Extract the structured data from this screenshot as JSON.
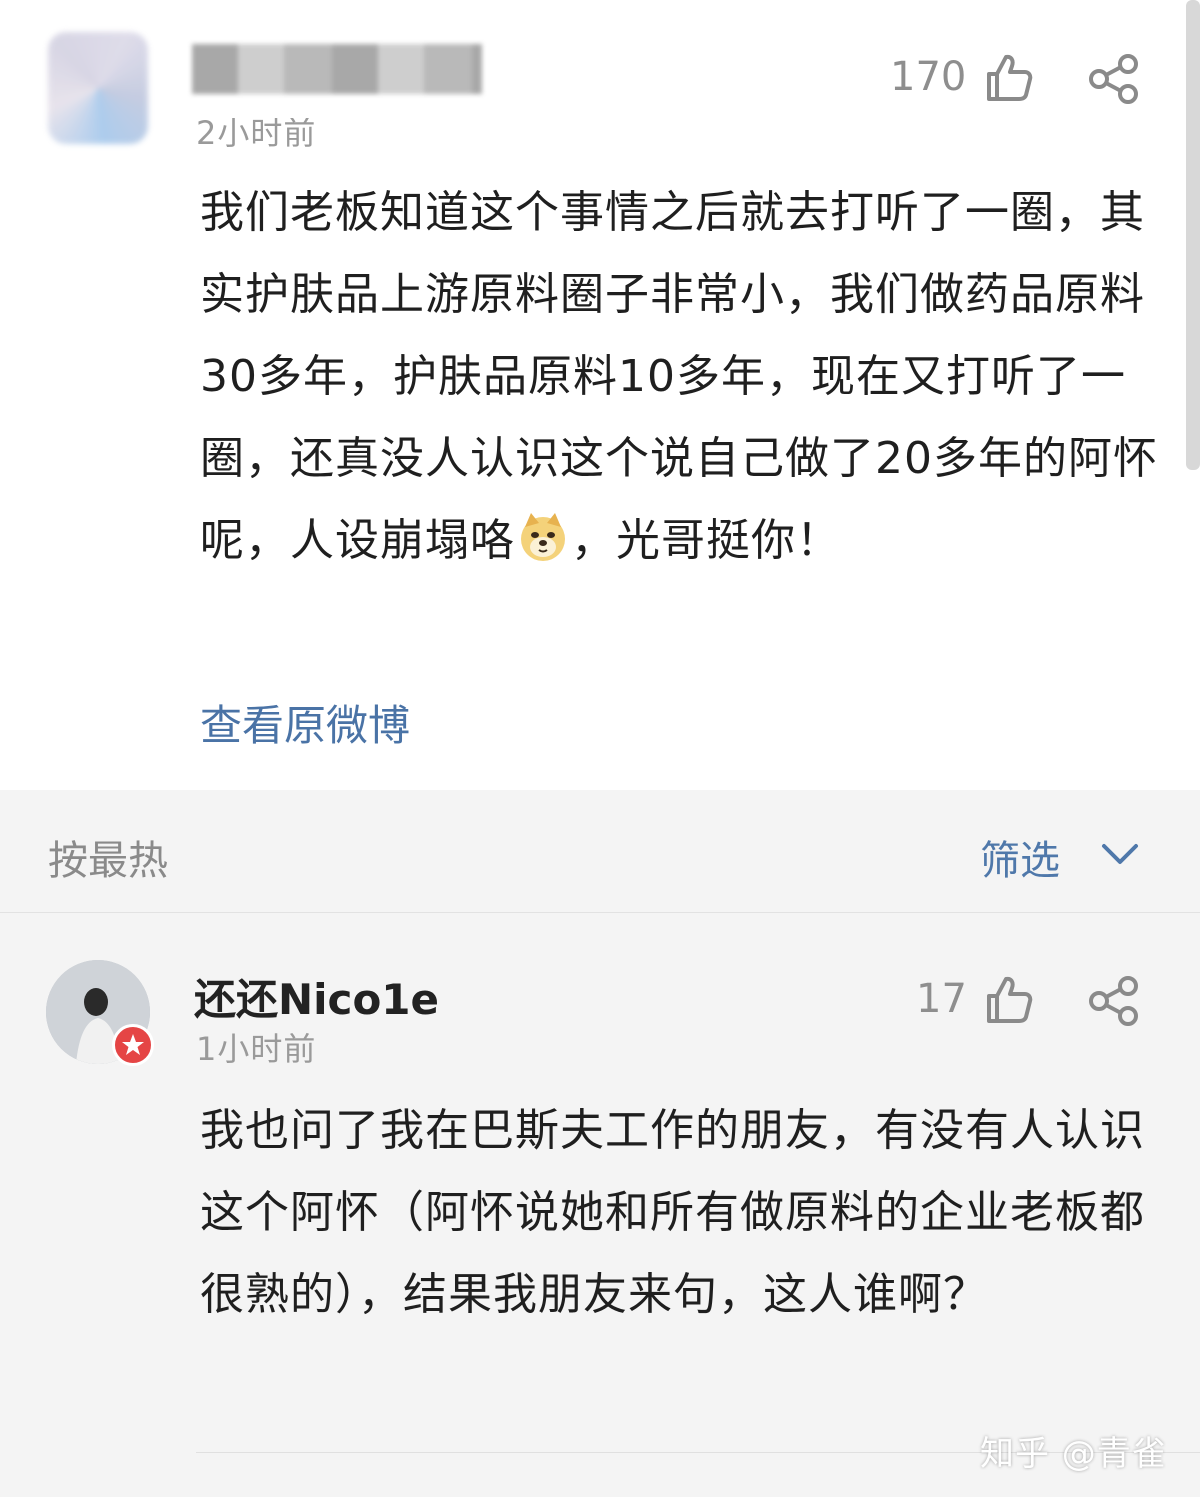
{
  "main_comment": {
    "time": "2小时前",
    "likes": "170",
    "text": "我们老板知道这个事情之后就去打听了一圈，其实护肤品上游原料圈子非常小，我们做药品原料30多年，护肤品原料10多年，现在又打听了一圈，还真没人认识这个说自己做了20多年的阿怀呢，人设崩塌咯",
    "text_after_emoji": "，光哥挺你！",
    "emoji": "doge-emoji",
    "view_original": "查看原微博"
  },
  "sort_bar": {
    "sort_label": "按最热",
    "filter_label": "筛选"
  },
  "reply": {
    "username": "还还Nico1e",
    "time": "1小时前",
    "likes": "17",
    "text": "我也问了我在巴斯夫工作的朋友，有没有人认识这个阿怀（阿怀说她和所有做原料的企业老板都很熟的），结果我朋友来句，这人谁啊？"
  },
  "watermark": "知乎 @青雀",
  "colors": {
    "link": "#4a73a6",
    "filter": "#4f78aa",
    "badge": "#e54545",
    "secondary_text": "#9a9a9a"
  },
  "icons": [
    "thumbs-up-icon",
    "share-icon",
    "chevron-down-icon",
    "verified-badge-icon"
  ]
}
